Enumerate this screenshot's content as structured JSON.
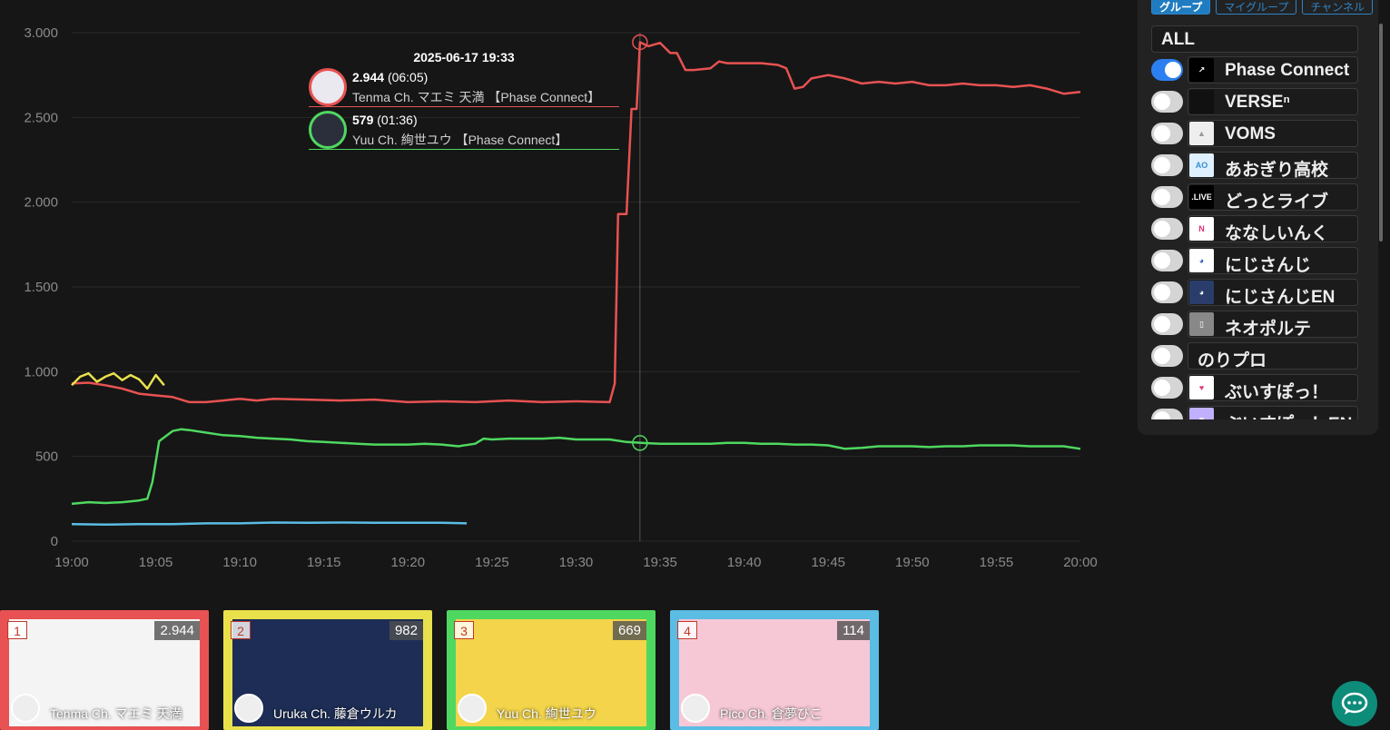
{
  "chart_data": {
    "type": "line",
    "x_ticks": [
      "19:00",
      "19:05",
      "19:10",
      "19:15",
      "19:20",
      "19:25",
      "19:30",
      "19:35",
      "19:40",
      "19:45",
      "19:50",
      "19:55",
      "20:00"
    ],
    "y_ticks": [
      "0",
      "500",
      "1.000",
      "1.500",
      "2.000",
      "2.500",
      "3.000"
    ],
    "ylim": [
      0,
      3000
    ],
    "x_range_minutes": [
      0,
      60
    ],
    "grid": true,
    "series": [
      {
        "name": "Tenma Ch. マエミ 天満 【Phase Connect】",
        "color": "#e85252",
        "points": [
          [
            0,
            930
          ],
          [
            1,
            935
          ],
          [
            2,
            920
          ],
          [
            3,
            900
          ],
          [
            4,
            870
          ],
          [
            5,
            860
          ],
          [
            6,
            850
          ],
          [
            7,
            820
          ],
          [
            8,
            820
          ],
          [
            9,
            830
          ],
          [
            10,
            840
          ],
          [
            11,
            830
          ],
          [
            12,
            840
          ],
          [
            14,
            835
          ],
          [
            16,
            830
          ],
          [
            18,
            835
          ],
          [
            20,
            820
          ],
          [
            22,
            825
          ],
          [
            24,
            820
          ],
          [
            26,
            830
          ],
          [
            28,
            820
          ],
          [
            30,
            825
          ],
          [
            32,
            820
          ],
          [
            32.3,
            930
          ],
          [
            32.5,
            1930
          ],
          [
            33,
            1930
          ],
          [
            33.3,
            2550
          ],
          [
            33.6,
            2550
          ],
          [
            33.8,
            2944
          ],
          [
            34.3,
            2920
          ],
          [
            35,
            2940
          ],
          [
            35.6,
            2880
          ],
          [
            36,
            2880
          ],
          [
            36.5,
            2780
          ],
          [
            37,
            2780
          ],
          [
            38,
            2790
          ],
          [
            38.5,
            2830
          ],
          [
            39,
            2820
          ],
          [
            40,
            2820
          ],
          [
            41,
            2820
          ],
          [
            42,
            2810
          ],
          [
            42.5,
            2790
          ],
          [
            43,
            2670
          ],
          [
            43.5,
            2680
          ],
          [
            44,
            2730
          ],
          [
            45,
            2750
          ],
          [
            46,
            2730
          ],
          [
            47,
            2700
          ],
          [
            48,
            2710
          ],
          [
            49,
            2700
          ],
          [
            50,
            2710
          ],
          [
            51,
            2690
          ],
          [
            52,
            2690
          ],
          [
            53,
            2700
          ],
          [
            54,
            2690
          ],
          [
            55,
            2690
          ],
          [
            56,
            2680
          ],
          [
            57,
            2690
          ],
          [
            58,
            2670
          ],
          [
            59,
            2640
          ],
          [
            60,
            2650
          ]
        ]
      },
      {
        "name": "Yuu Ch. 絢世ユウ 【Phase Connect】",
        "color": "#4fd860",
        "points": [
          [
            0,
            220
          ],
          [
            1,
            230
          ],
          [
            2,
            225
          ],
          [
            3,
            230
          ],
          [
            4,
            240
          ],
          [
            4.5,
            250
          ],
          [
            4.8,
            350
          ],
          [
            5.2,
            590
          ],
          [
            6,
            650
          ],
          [
            6.5,
            660
          ],
          [
            7,
            655
          ],
          [
            8,
            640
          ],
          [
            9,
            625
          ],
          [
            10,
            620
          ],
          [
            11,
            610
          ],
          [
            12,
            605
          ],
          [
            13,
            600
          ],
          [
            14,
            590
          ],
          [
            15,
            585
          ],
          [
            16,
            580
          ],
          [
            17,
            575
          ],
          [
            18,
            570
          ],
          [
            19,
            570
          ],
          [
            20,
            570
          ],
          [
            21,
            575
          ],
          [
            22,
            570
          ],
          [
            23,
            560
          ],
          [
            24,
            575
          ],
          [
            24.5,
            605
          ],
          [
            25,
            600
          ],
          [
            26,
            605
          ],
          [
            27,
            605
          ],
          [
            28,
            605
          ],
          [
            29,
            610
          ],
          [
            30,
            600
          ],
          [
            31,
            600
          ],
          [
            32,
            600
          ],
          [
            33,
            585
          ],
          [
            34,
            579
          ],
          [
            35,
            575
          ],
          [
            36,
            575
          ],
          [
            37,
            575
          ],
          [
            38,
            575
          ],
          [
            39,
            580
          ],
          [
            40,
            580
          ],
          [
            41,
            575
          ],
          [
            42,
            575
          ],
          [
            43,
            570
          ],
          [
            44,
            570
          ],
          [
            45,
            565
          ],
          [
            46,
            545
          ],
          [
            47,
            550
          ],
          [
            48,
            560
          ],
          [
            49,
            560
          ],
          [
            50,
            560
          ],
          [
            51,
            555
          ],
          [
            52,
            560
          ],
          [
            53,
            560
          ],
          [
            54,
            565
          ],
          [
            55,
            565
          ],
          [
            56,
            565
          ],
          [
            57,
            560
          ],
          [
            58,
            560
          ],
          [
            59,
            560
          ],
          [
            60,
            545
          ]
        ]
      },
      {
        "name": "Uruka Ch. 藤倉ウルカ",
        "color": "#e9e14c",
        "points": [
          [
            0,
            920
          ],
          [
            0.5,
            970
          ],
          [
            1,
            990
          ],
          [
            1.5,
            940
          ],
          [
            2,
            970
          ],
          [
            2.5,
            990
          ],
          [
            3,
            950
          ],
          [
            3.5,
            980
          ],
          [
            4,
            955
          ],
          [
            4.5,
            900
          ],
          [
            5,
            980
          ],
          [
            5.5,
            920
          ]
        ]
      },
      {
        "name": "Pico Ch. 倉夢ぴこ",
        "color": "#5bbce4",
        "points": [
          [
            0,
            100
          ],
          [
            2,
            98
          ],
          [
            4,
            100
          ],
          [
            6,
            100
          ],
          [
            8,
            105
          ],
          [
            10,
            105
          ],
          [
            12,
            110
          ],
          [
            14,
            108
          ],
          [
            16,
            110
          ],
          [
            18,
            108
          ],
          [
            20,
            108
          ],
          [
            22,
            108
          ],
          [
            23.5,
            105
          ]
        ]
      }
    ]
  },
  "tooltip": {
    "date": "2025-06-17 19:33",
    "rows": [
      {
        "value": "2.944",
        "duration": "(06:05)",
        "name": "Tenma Ch. マエミ 天満 【Phase Connect】",
        "color": "#e85252"
      },
      {
        "value": "579",
        "duration": "(01:36)",
        "name": "Yuu Ch. 絢世ユウ 【Phase Connect】",
        "color": "#4fd860"
      }
    ]
  },
  "sidebar": {
    "tabs": [
      "グループ",
      "マイグループ",
      "チャンネル"
    ],
    "all_label": "ALL",
    "groups": [
      {
        "label": "Phase Connect",
        "on": true,
        "logo": "↗",
        "logo_bg": "#000",
        "logo_fg": "#fff"
      },
      {
        "label": "VERSEⁿ",
        "on": false,
        "logo": "",
        "logo_bg": "#111",
        "logo_fg": "#fff"
      },
      {
        "label": "VOMS",
        "on": false,
        "logo": "▲",
        "logo_bg": "#eee",
        "logo_fg": "#999"
      },
      {
        "label": "あおぎり高校",
        "on": false,
        "logo": "AO",
        "logo_bg": "#dff0ff",
        "logo_fg": "#3a8fd0"
      },
      {
        "label": "どっとライブ",
        "on": false,
        "logo": ".LIVE",
        "logo_bg": "#000",
        "logo_fg": "#fff"
      },
      {
        "label": "ななしいんく",
        "on": false,
        "logo": "N",
        "logo_bg": "#fff",
        "logo_fg": "#e0307a"
      },
      {
        "label": "にじさんじ",
        "on": false,
        "logo": "◕",
        "logo_bg": "#fff",
        "logo_fg": "#2f5fbf"
      },
      {
        "label": "にじさんじEN",
        "on": false,
        "logo": "◕",
        "logo_bg": "#2a3d6a",
        "logo_fg": "#fff"
      },
      {
        "label": "ネオポルテ",
        "on": false,
        "logo": "▯",
        "logo_bg": "#888",
        "logo_fg": "#fff"
      },
      {
        "label": "のりプロ",
        "on": false,
        "logo": "",
        "logo_bg": "",
        "logo_fg": ""
      },
      {
        "label": "ぶいすぽっ！",
        "on": false,
        "logo": "♥",
        "logo_bg": "#fff",
        "logo_fg": "#e04080"
      },
      {
        "label": "ぶいすぽっ！EN",
        "on": false,
        "logo": "♥",
        "logo_bg": "#c0b0ff",
        "logo_fg": "#fff"
      }
    ]
  },
  "cards": [
    {
      "rank": "1",
      "count": "2.944",
      "name": "Tenma Ch. マエミ 天満",
      "border": "#e85252",
      "thumb_bg": "#f4f4f4"
    },
    {
      "rank": "2",
      "count": "982",
      "name": "Uruka Ch. 藤倉ウルカ",
      "border": "#e9e14c",
      "thumb_bg": "#1d2d55"
    },
    {
      "rank": "3",
      "count": "669",
      "name": "Yuu Ch. 絢世ユウ",
      "border": "#4fd860",
      "thumb_bg": "#f3d44a"
    },
    {
      "rank": "4",
      "count": "114",
      "name": "Pico Ch. 倉夢ぴこ",
      "border": "#5bbce4",
      "thumb_bg": "#f6c8d6"
    }
  ]
}
